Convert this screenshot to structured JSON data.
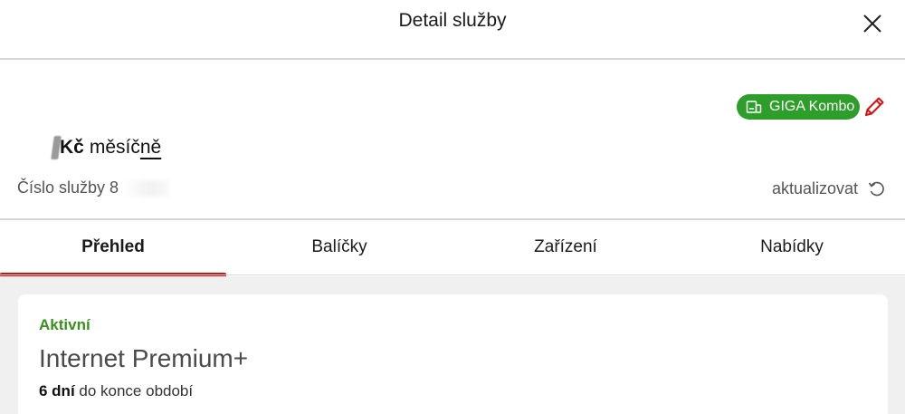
{
  "header": {
    "title": "Detail služby",
    "close_icon": "close-icon"
  },
  "plan_badge": {
    "label": "GIGA Kombo",
    "icon": "package-icon",
    "color": "#2d9e2a"
  },
  "edit_icon": "pencil-icon",
  "price": {
    "currency": "Kč",
    "period_prefix": "měsíč",
    "period_underlined": "ně"
  },
  "service_number": {
    "label": "Číslo služby 8"
  },
  "refresh": {
    "label": "aktualizovat",
    "icon": "refresh-icon"
  },
  "tabs": [
    {
      "label": "Přehled",
      "active": true
    },
    {
      "label": "Balíčky",
      "active": false
    },
    {
      "label": "Zařízení",
      "active": false
    },
    {
      "label": "Nabídky",
      "active": false
    }
  ],
  "accent_color": "#d11212",
  "card": {
    "status": "Aktivní",
    "status_color": "#3a8f1e",
    "plan_name": "Internet Premium+",
    "days_count": "6 dní",
    "days_suffix": " do konce období"
  }
}
